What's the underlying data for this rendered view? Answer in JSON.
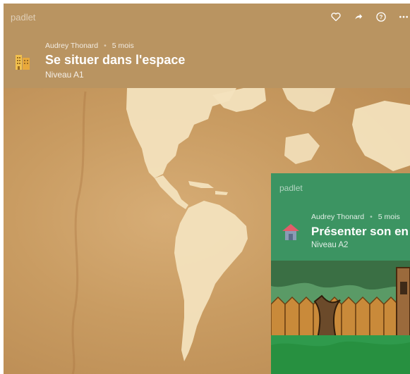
{
  "board1": {
    "brand": "padlet",
    "actions": [
      {
        "name": "like-heart-icon",
        "glyph": "♡"
      },
      {
        "name": "share-arrow-icon",
        "glyph": "➦"
      },
      {
        "name": "help-icon",
        "glyph": "?"
      },
      {
        "name": "more-options-icon",
        "glyph": "⋯"
      }
    ],
    "author": "Audrey Thonard",
    "age": "5 mois",
    "title": "Se situer dans l'espace",
    "subtitle": "Niveau A1",
    "icon": "building-icon",
    "accent": "#b99461"
  },
  "board2": {
    "brand": "padlet",
    "author": "Audrey Thonard",
    "age": "5 mois",
    "title": "Présenter son en",
    "subtitle": "Niveau A2",
    "icon": "house-icon",
    "accent": "#3c9462"
  }
}
